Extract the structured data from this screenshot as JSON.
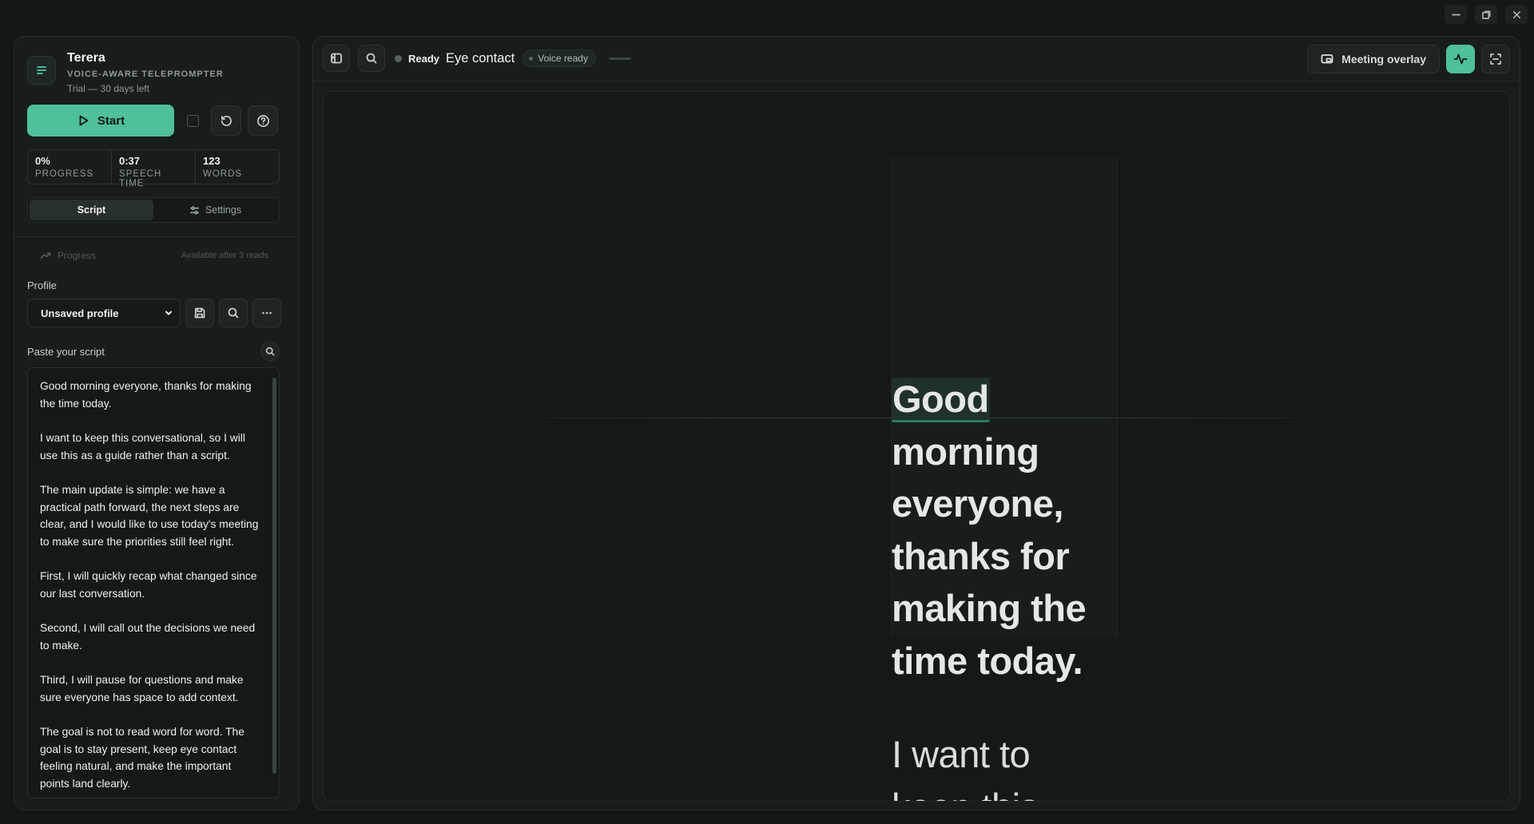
{
  "window": {
    "controls": [
      "minimize",
      "restore",
      "close"
    ]
  },
  "brand": {
    "name": "Terera",
    "tagline": "VOICE-AWARE TELEPROMPTER",
    "trial": "Trial — 30 days left"
  },
  "controls": {
    "start_label": "Start"
  },
  "stats": [
    {
      "value": "0%",
      "label": "PROGRESS"
    },
    {
      "value": "0:37",
      "label": "SPEECH TIME"
    },
    {
      "value": "123",
      "label": "WORDS"
    }
  ],
  "tabs": [
    {
      "label": "Script",
      "active": true
    },
    {
      "label": "Settings",
      "active": false
    }
  ],
  "progress": {
    "label": "Progress",
    "note": "Available after 3 reads"
  },
  "profile": {
    "label": "Profile",
    "selected": "Unsaved profile"
  },
  "script": {
    "label": "Paste your script",
    "paragraphs": [
      "Good morning everyone, thanks for making the time today.",
      "I want to keep this conversational, so I will use this as a guide rather than a script.",
      "The main update is simple: we have a practical path forward, the next steps are clear, and I would like to use today's meeting to make sure the priorities still feel right.",
      "First, I will quickly recap what changed since our last conversation.",
      "Second, I will call out the decisions we need to make.",
      "Third, I will pause for questions and make sure everyone has space to add context.",
      "The goal is not to read word for word. The goal is to stay present, keep eye contact feeling natural, and make the important points land clearly."
    ]
  },
  "topbar": {
    "status": "Ready",
    "mode": "Eye contact",
    "voice": "Voice ready",
    "overlay_label": "Meeting overlay"
  },
  "prompter": {
    "current_word": "Good",
    "para1_rest": [
      "morning",
      "everyone,",
      "thanks for",
      "making the",
      "time today."
    ],
    "para2": [
      "I want to",
      "keep this"
    ]
  },
  "colors": {
    "accent": "#4fbf9c",
    "background": "#131817",
    "panel": "#171d1c"
  }
}
